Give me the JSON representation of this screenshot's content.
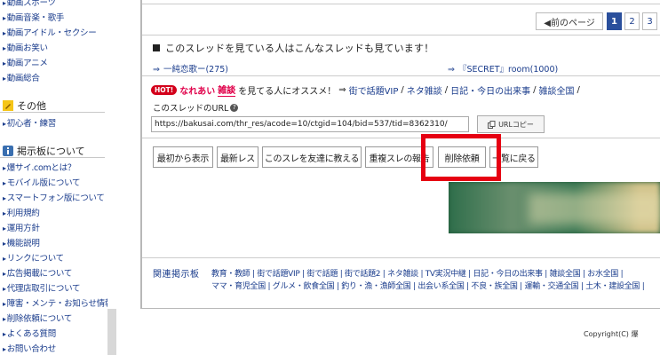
{
  "sidebar": {
    "top_items": [
      "動画スポーツ",
      "動画音楽・歌手",
      "動画アイドル・セクシー",
      "動画お笑い",
      "動画アニメ",
      "動画総合"
    ],
    "other_heading": "その他",
    "other_items": [
      "初心者・練習"
    ],
    "about_heading": "掲示板について",
    "about_items": [
      "爆サイ.comとは？",
      "モバイル版について",
      "スマートフォン版について",
      "利用規約",
      "運用方針",
      "機能説明",
      "リンクについて",
      "広告掲載について",
      "代理店取引について",
      "障害・メンテ・お知らせ情報",
      "削除依頼について",
      "よくある質問",
      "お問い合わせ"
    ]
  },
  "pagination": {
    "prev_label": "◀前のページ",
    "pages": [
      "1",
      "2",
      "3"
    ]
  },
  "related": {
    "heading": "このスレッドを見ている人はこんなスレッドも見ています！",
    "arrow": "⇒",
    "link1": "一純恋歌ー(275)",
    "link2": "『SECRET』room(1000)"
  },
  "recommend": {
    "badge": "HOT!",
    "text_red1": "なれあい",
    "text_red2": "雑談",
    "text_plain": "を見てる人にオススメ！",
    "arrow": "⇒",
    "links": [
      "街で話題VIP",
      "ネタ雑談",
      "日記・今日の出来事",
      "雑談全国"
    ],
    "sep": "/"
  },
  "url_box": {
    "label": "このスレッドのURL",
    "value": "https://bakusai.com/thr_res/acode=10/ctgid=104/bid=537/tid=8362310/",
    "copy_label": "URLコピー"
  },
  "actions": {
    "first": "最初から表示",
    "latest": "最新レス",
    "tell": "このスレを友達に教える",
    "report": "重複スレの報告",
    "delete": "削除依頼",
    "back": "一覧に戻る"
  },
  "footer": {
    "label": "関連掲示板",
    "line1": "教育・教師 | 街で話題VIP | 街で話題 | 街で話題2 | ネタ雑談 | TV実況中継 | 日記・今日の出来事 | 雑談全国 | お水全国 |",
    "line2": "ママ・育児全国 | グルメ・飲食全国 | 釣り・漁・漁師全国 | 出会い系全国 | 不良・族全国 | 運輸・交通全国 | 土木・建設全国 |"
  },
  "copyright": "Copyright(C) 爆",
  "colors": {
    "link": "#1a3c8c",
    "accent": "#2a4f9c",
    "hot": "#d3001b",
    "highlight": "#e60012"
  }
}
